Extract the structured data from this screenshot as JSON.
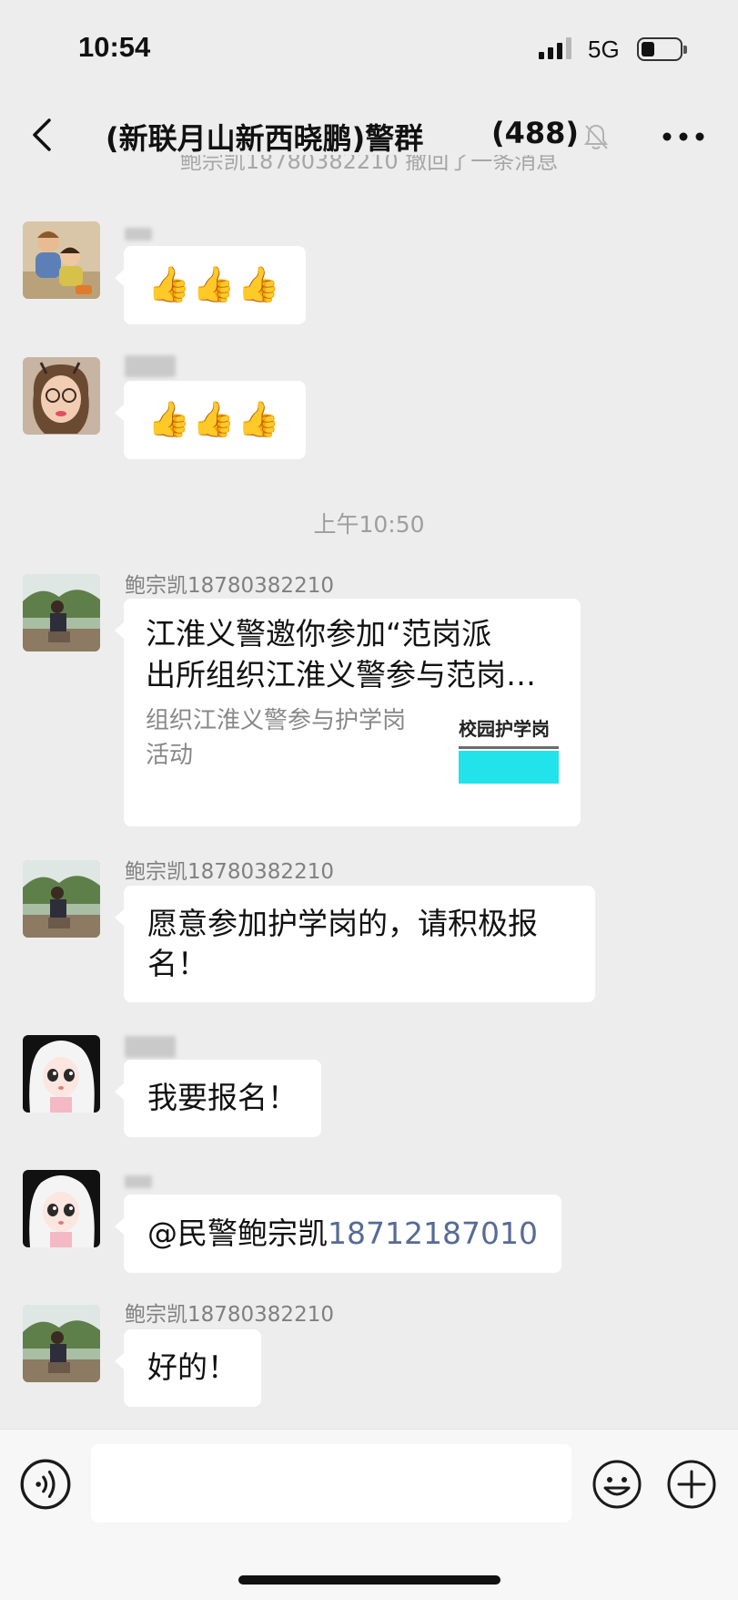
{
  "status_bar": {
    "time": "10:54",
    "network": "5G"
  },
  "nav": {
    "title": "(新联月山新西晓鹏)警群",
    "member_count": "(488)"
  },
  "notice_partial": "鲍宗凯18780382210 撤回了一条消息",
  "messages": [
    {
      "type": "text",
      "sender": "",
      "content": "👍👍👍",
      "avatar": "child-photo"
    },
    {
      "type": "text",
      "sender": "",
      "content": "👍👍👍",
      "avatar": "girl-glasses-photo"
    },
    {
      "type": "time",
      "content": "上午10:50"
    },
    {
      "type": "card",
      "sender": "鲍宗凯18780382210",
      "title_line1": "江淮义警邀你参加“范岗派",
      "title_line2": "出所组织江淮义警参与范岗派出所组织江淮义警参与护学岗活动”",
      "description": "组织江淮义警参与护学岗活动",
      "thumb_text": "校园护学岗",
      "avatar": "park-man-photo"
    },
    {
      "type": "text",
      "sender": "鲍宗凯18780382210",
      "content": "愿意参加护学岗的，请积极报名！",
      "avatar": "park-man-photo"
    },
    {
      "type": "text",
      "sender": "",
      "content": "我要报名！",
      "avatar": "anime-girl"
    },
    {
      "type": "text",
      "sender": "",
      "content_prefix": "@民警鲍宗凯",
      "content_link": "18712187010",
      "avatar": "anime-girl"
    },
    {
      "type": "text",
      "sender": "鲍宗凯18780382210",
      "content": "好的！",
      "avatar": "park-man-photo"
    }
  ],
  "input": {
    "placeholder": ""
  },
  "icons": {
    "back": "chevron-left-icon",
    "mute": "bell-slash-icon",
    "more": "more-dots-icon",
    "voice": "voice-icon",
    "emoji": "smiley-icon",
    "plus": "plus-icon"
  },
  "colors": {
    "background": "#ededed",
    "bubble": "#ffffff",
    "link": "#576b95",
    "card_thumb": "#22e3ea"
  }
}
